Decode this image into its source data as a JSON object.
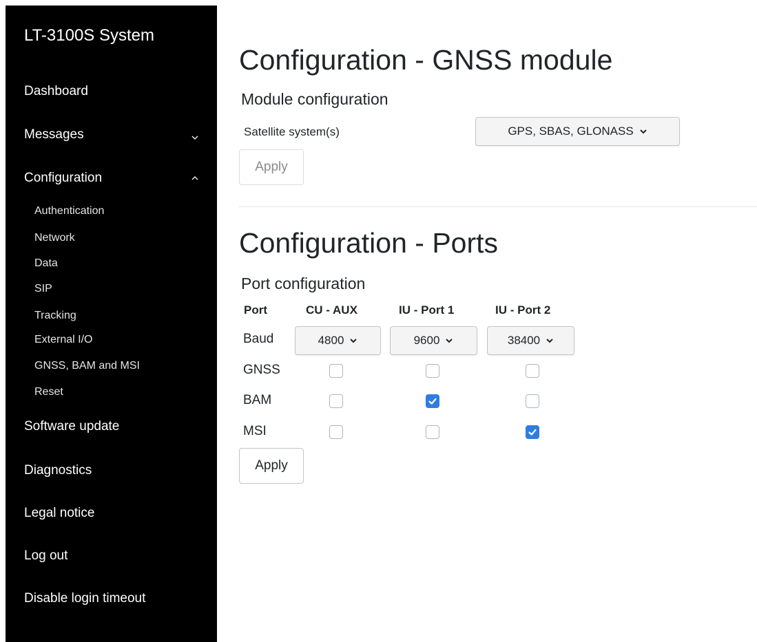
{
  "sidebar": {
    "brand": "LT-3100S System",
    "items": {
      "dashboard": "Dashboard",
      "messages": "Messages",
      "configuration": "Configuration",
      "software_update": "Software update",
      "diagnostics": "Diagnostics",
      "legal_notice": "Legal notice",
      "log_out": "Log out",
      "disable_login_timeout": "Disable login timeout"
    },
    "configuration_sub": {
      "authentication": "Authentication",
      "network": "Network",
      "data": "Data",
      "sip": "SIP",
      "tracking": "Tracking",
      "external_io": "External I/O",
      "gnss_bam_msi": "GNSS, BAM and MSI",
      "reset": "Reset"
    },
    "icons": {
      "messages": "chevron-down-icon",
      "configuration": "chevron-up-icon"
    }
  },
  "gnss": {
    "title": "Configuration - GNSS module",
    "subtitle": "Module configuration",
    "satellite_label": "Satellite system(s)",
    "satellite_value": "GPS, SBAS, GLONASS",
    "apply_label": "Apply"
  },
  "ports": {
    "title": "Configuration - Ports",
    "subtitle": "Port configuration",
    "headers": {
      "port": "Port",
      "cu_aux": "CU - AUX",
      "iu_port1": "IU - Port 1",
      "iu_port2": "IU - Port 2"
    },
    "row_labels": {
      "baud": "Baud",
      "gnss": "GNSS",
      "bam": "BAM",
      "msi": "MSI"
    },
    "baud": {
      "cu_aux": "4800",
      "iu_port1": "9600",
      "iu_port2": "38400"
    },
    "checked": {
      "gnss": [
        false,
        false,
        false
      ],
      "bam": [
        false,
        true,
        false
      ],
      "msi": [
        false,
        false,
        true
      ]
    },
    "apply_label": "Apply"
  },
  "colors": {
    "sidebar_bg": "#000000",
    "checkbox_checked": "#2f7de1"
  }
}
